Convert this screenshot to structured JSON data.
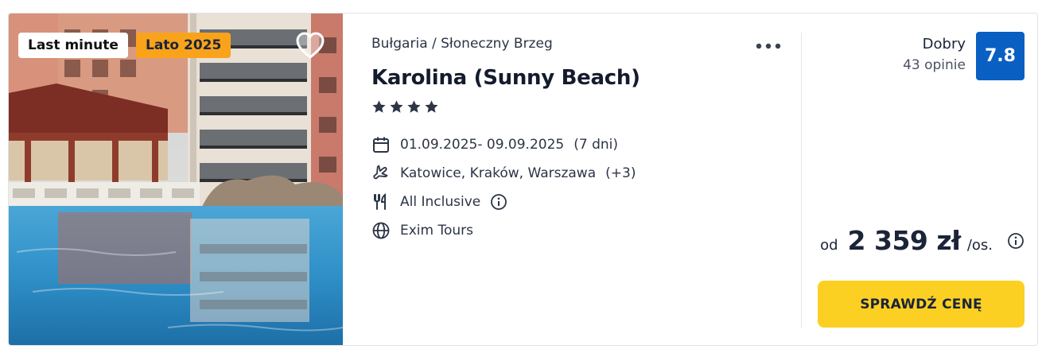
{
  "offer": {
    "badges": {
      "last_minute": "Last minute",
      "season": "Lato 2025"
    },
    "location": "Bułgaria / Słoneczny Brzeg",
    "hotel_name": "Karolina (Sunny Beach)",
    "stars": 4,
    "dates": "01.09.2025- 09.09.2025",
    "duration": "(7 dni)",
    "departures": "Katowice, Kraków, Warszawa",
    "departures_extra": "(+3)",
    "board": "All Inclusive",
    "operator": "Exim Tours",
    "rating": {
      "label": "Dobry",
      "reviews": "43 opinie",
      "score": "7.8"
    },
    "price": {
      "prefix": "od",
      "amount": "2 359 zł",
      "unit": "/os."
    },
    "cta_label": "SPRAWDŹ CENĘ"
  },
  "icons": {
    "favorite": "heart-icon",
    "more": "more-dots-icon",
    "date": "calendar-icon",
    "departure": "plane-icon",
    "board": "cutlery-icon",
    "operator": "globe-icon",
    "info": "info-icon"
  },
  "colors": {
    "season_badge": "#f9a31b",
    "score_badge": "#0a5fc2",
    "cta": "#fcd023",
    "text": "#1b2438"
  }
}
